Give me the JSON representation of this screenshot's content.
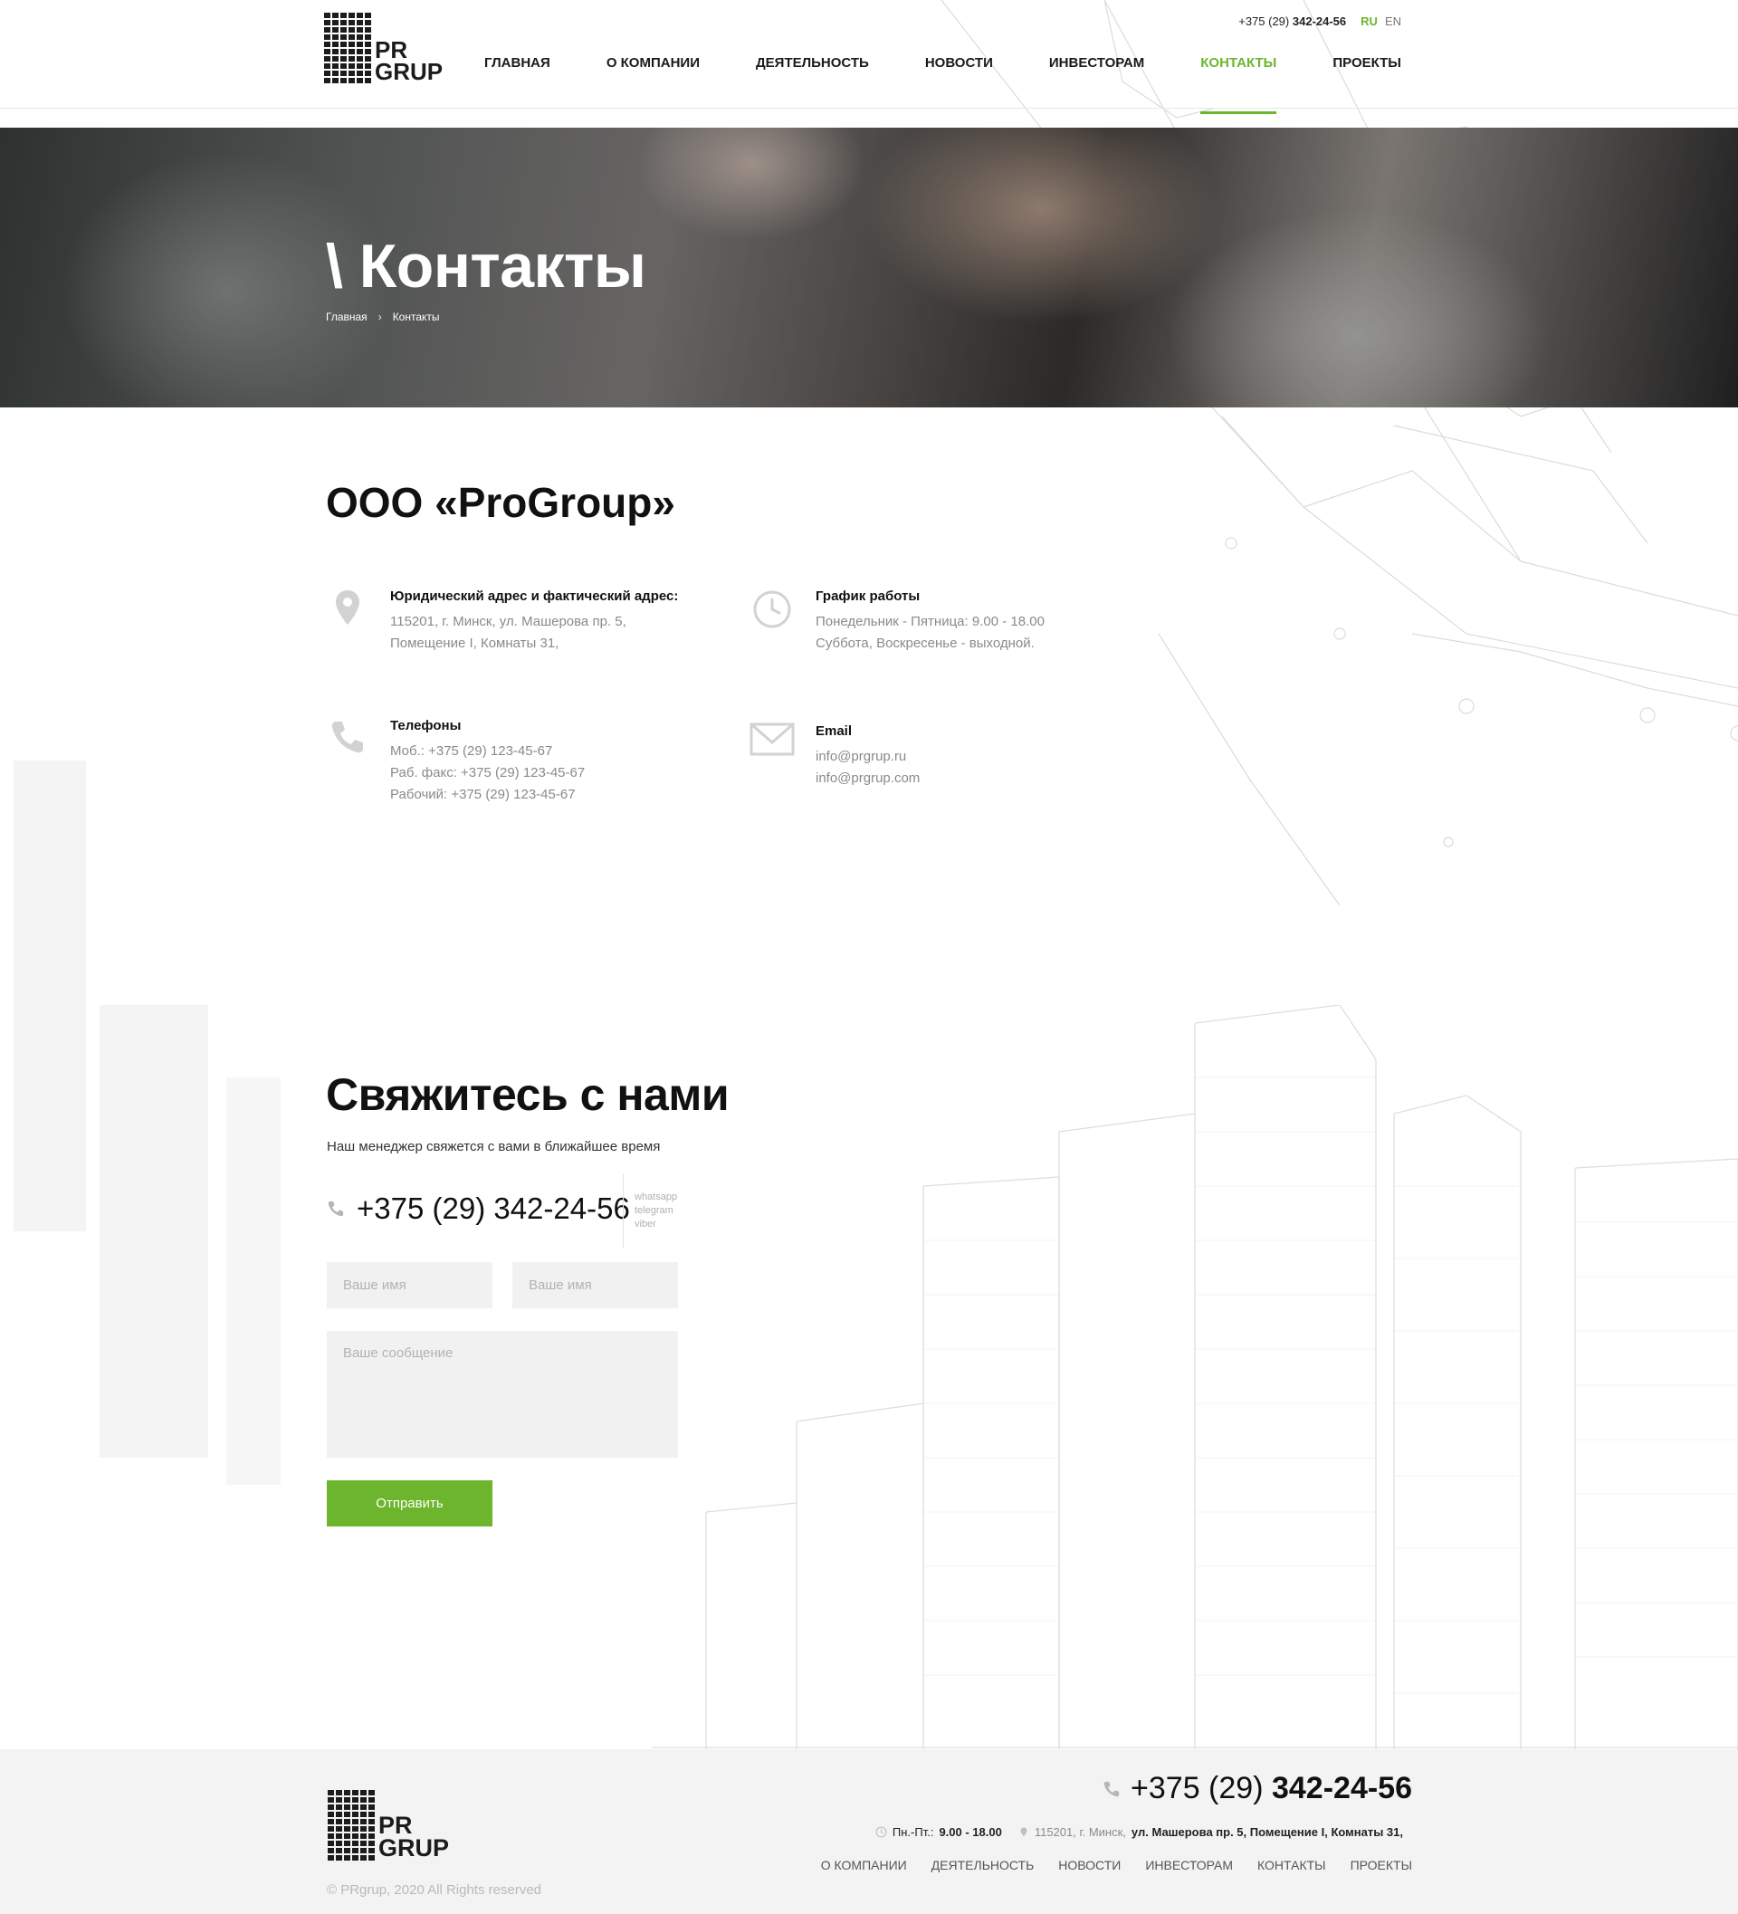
{
  "brand": {
    "logo_text_line1": "PR",
    "logo_text_line2": "GRUP"
  },
  "header": {
    "phone_prefix": "+375 (29)",
    "phone_number": "342-24-56",
    "languages": [
      "RU",
      "EN"
    ],
    "active_language": "RU",
    "nav": [
      {
        "label": "ГЛАВНАЯ",
        "active": false
      },
      {
        "label": "О КОМПАНИИ",
        "active": false
      },
      {
        "label": "ДЕЯТЕЛЬНОСТЬ",
        "active": false
      },
      {
        "label": "НОВОСТИ",
        "active": false
      },
      {
        "label": "ИНВЕСТОРАМ",
        "active": false
      },
      {
        "label": "КОНТАКТЫ",
        "active": true
      },
      {
        "label": "ПРОЕКТЫ",
        "active": false
      }
    ]
  },
  "hero": {
    "title": "\\ Контакты",
    "breadcrumb": [
      "Главная",
      "Контакты"
    ]
  },
  "company": {
    "name": "ООО «ProGroup»",
    "address": {
      "icon": "map-pin-icon",
      "title": "Юридический адрес и фактический адрес:",
      "lines": [
        "115201, г. Минск, ул. Машерова пр. 5,",
        "Помещение I, Комнаты 31,"
      ]
    },
    "schedule": {
      "icon": "clock-icon",
      "title": "График работы",
      "lines": [
        "Понедельник - Пятница: 9.00 - 18.00",
        "Суббота, Воскресенье - выходной."
      ]
    },
    "phones": {
      "icon": "phone-icon",
      "title": "Телефоны",
      "lines": [
        "Моб.: +375 (29) 123-45-67",
        "Раб. факс: +375 (29) 123-45-67",
        "Рабочий: +375 (29) 123-45-67"
      ]
    },
    "email": {
      "icon": "envelope-icon",
      "title": "Email",
      "lines": [
        "info@prgrup.ru",
        "info@prgrup.com"
      ]
    }
  },
  "contact_form": {
    "title": "Свяжитесь с нами",
    "subtitle": "Наш менеджер свяжется с вами в ближайшее время",
    "phone": "+375 (29) 342-24-56",
    "messengers": [
      "whatsapp",
      "telegram",
      "viber"
    ],
    "name_placeholder_1": "Ваше имя",
    "name_placeholder_2": "Ваше имя",
    "message_placeholder": "Ваше сообщение",
    "submit_label": "Отправить"
  },
  "footer": {
    "phone_prefix": "+375 (29) ",
    "phone_number": "342-24-56",
    "hours_label": "Пн.-Пт.:",
    "hours_value": "9.00 - 18.00",
    "address_prefix": "115201, г. Минск,",
    "address_bold": "ул. Машерова пр. 5, Помещение I, Комнаты 31,",
    "nav": [
      "О КОМПАНИИ",
      "ДЕЯТЕЛЬНОСТЬ",
      "НОВОСТИ",
      "ИНВЕСТОРАМ",
      "КОНТАКТЫ",
      "ПРОЕКТЫ"
    ],
    "copyright": "© PRgrup, 2020 All Rights reserved"
  },
  "colors": {
    "accent": "#6cb52d",
    "text": "#111111",
    "muted": "#8a8a8a",
    "field_bg": "#f1f1f1",
    "footer_bg": "#f3f3f3"
  }
}
